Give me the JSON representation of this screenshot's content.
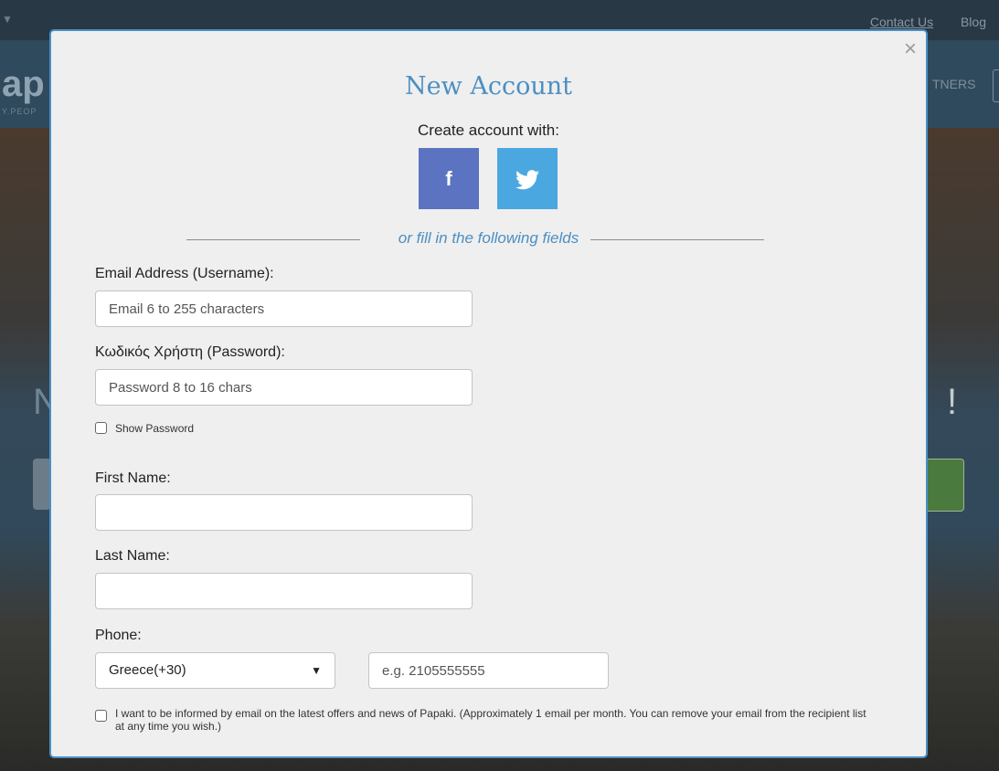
{
  "site": {
    "top_links": [
      "Contact Us",
      "Blog"
    ],
    "logo_text": "ap",
    "logo_tagline": "Y.PEOP",
    "nav_partial": "TNERS",
    "hero_left_partial": "N",
    "hero_right_partial": "!"
  },
  "modal": {
    "title": "New Account",
    "subtitle": "Create account with:",
    "social": {
      "facebook_glyph": "f",
      "twitter_glyph": "🐦"
    },
    "divider_text": "or fill in the following fields",
    "email": {
      "label": "Email Address (Username):",
      "placeholder": "Email 6 to 255 characters",
      "value": ""
    },
    "password": {
      "label": "Κωδικός Χρήστη (Password):",
      "placeholder": "Password 8 to 16 chars",
      "value": ""
    },
    "show_password_label": "Show Password",
    "first_name": {
      "label": "First Name:",
      "value": ""
    },
    "last_name": {
      "label": "Last Name:",
      "value": ""
    },
    "phone": {
      "label": "Phone:",
      "country_selected": "Greece(+30)",
      "placeholder": "e.g. 2105555555"
    },
    "newsletter_label": "I want to be informed by email on the latest offers and news of Papaki. (Approximately 1 email per month. You can remove your email from the recipient list at any time you wish.)",
    "close_glyph": "×"
  },
  "colors": {
    "accent": "#4c8fc2",
    "facebook": "#5b73c0",
    "twitter": "#4ba7e0",
    "modal_border": "#4a8fc6"
  }
}
